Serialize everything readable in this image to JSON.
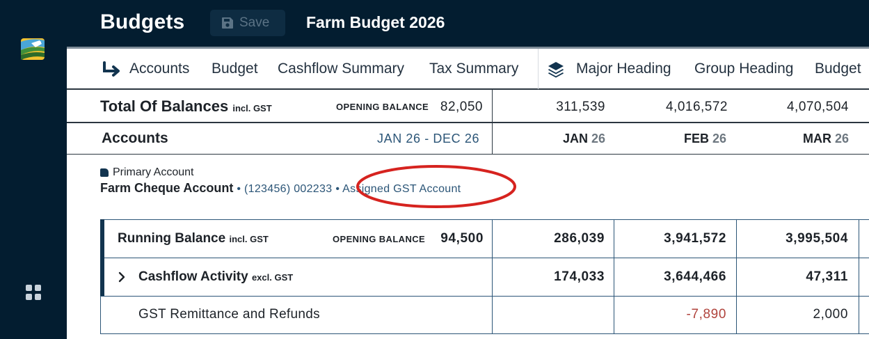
{
  "app": {
    "title": "Budgets",
    "save_label": "Save",
    "budget_name": "Farm Budget 2026"
  },
  "tabs": {
    "left": [
      "Accounts",
      "Budget",
      "Cashflow Summary",
      "Tax Summary"
    ],
    "right": [
      "Major Heading",
      "Group Heading",
      "Budget"
    ]
  },
  "totals": {
    "label": "Total Of Balances",
    "suffix": "incl. GST",
    "opening_label": "OPENING BALANCE",
    "opening_value": "82,050",
    "values": [
      "311,539",
      "4,016,572",
      "4,070,504"
    ]
  },
  "accounts_header": {
    "label": "Accounts",
    "range": "JAN 26 - DEC 26",
    "months": [
      {
        "m": "JAN",
        "y": "26"
      },
      {
        "m": "FEB",
        "y": "26"
      },
      {
        "m": "MAR",
        "y": "26"
      }
    ]
  },
  "account": {
    "type": "Primary Account",
    "name": "Farm Cheque Account",
    "number": "• (123456) 002233",
    "gst": "• Assigned GST Account",
    "highlight_color": "#d6231f"
  },
  "rows": {
    "running": {
      "label": "Running Balance",
      "suffix": "incl. GST",
      "opening_label": "OPENING BALANCE",
      "opening_value": "94,500",
      "values": [
        "286,039",
        "3,941,572",
        "3,995,504"
      ]
    },
    "activity": {
      "label": "Cashflow Activity",
      "suffix": "excl. GST",
      "values": [
        "174,033",
        "3,644,466",
        "47,311"
      ]
    },
    "gst": {
      "label": "GST Remittance and Refunds",
      "values": [
        "",
        "-7,890",
        "2,000"
      ]
    }
  },
  "colors": {
    "sidebar": "#031d30",
    "accent": "#12344f",
    "link": "#2b5577",
    "negative": "#b0433c"
  },
  "icons": [
    "app-logo",
    "save-icon",
    "arrow-right-icon",
    "layers-icon",
    "apps-grid-icon",
    "chevron-right-icon"
  ]
}
